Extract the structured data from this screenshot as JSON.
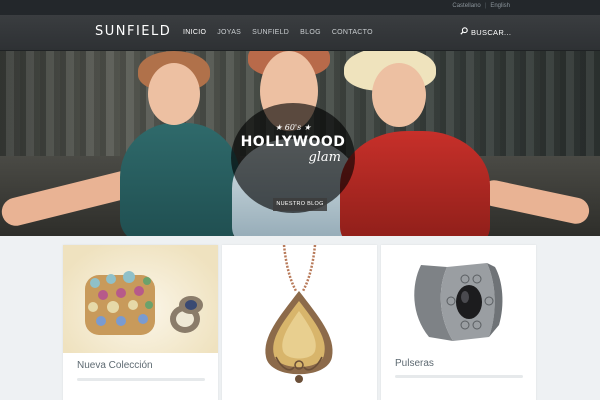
{
  "topbar": {
    "languages": [
      "Castellano",
      "English"
    ]
  },
  "header": {
    "logo": "SUNFIELD",
    "nav": [
      "INICIO",
      "JOYAS",
      "SUNFIELD",
      "BLOG",
      "CONTACTO"
    ],
    "active_nav": "INICIO",
    "search_label": "BUSCAR..."
  },
  "hero": {
    "era": "★ 60's ★",
    "headline": "HOLLYWOOD",
    "headline_script": "glam",
    "button_label": "NUESTRO BLOG"
  },
  "cards": [
    {
      "title": "Nueva Colección"
    },
    {
      "title": ""
    },
    {
      "title": "Pulseras"
    }
  ],
  "colors": {
    "topbar": "#23272b",
    "header": "#333639",
    "page_background": "#eef1f3",
    "card_title": "#5e6a72"
  }
}
